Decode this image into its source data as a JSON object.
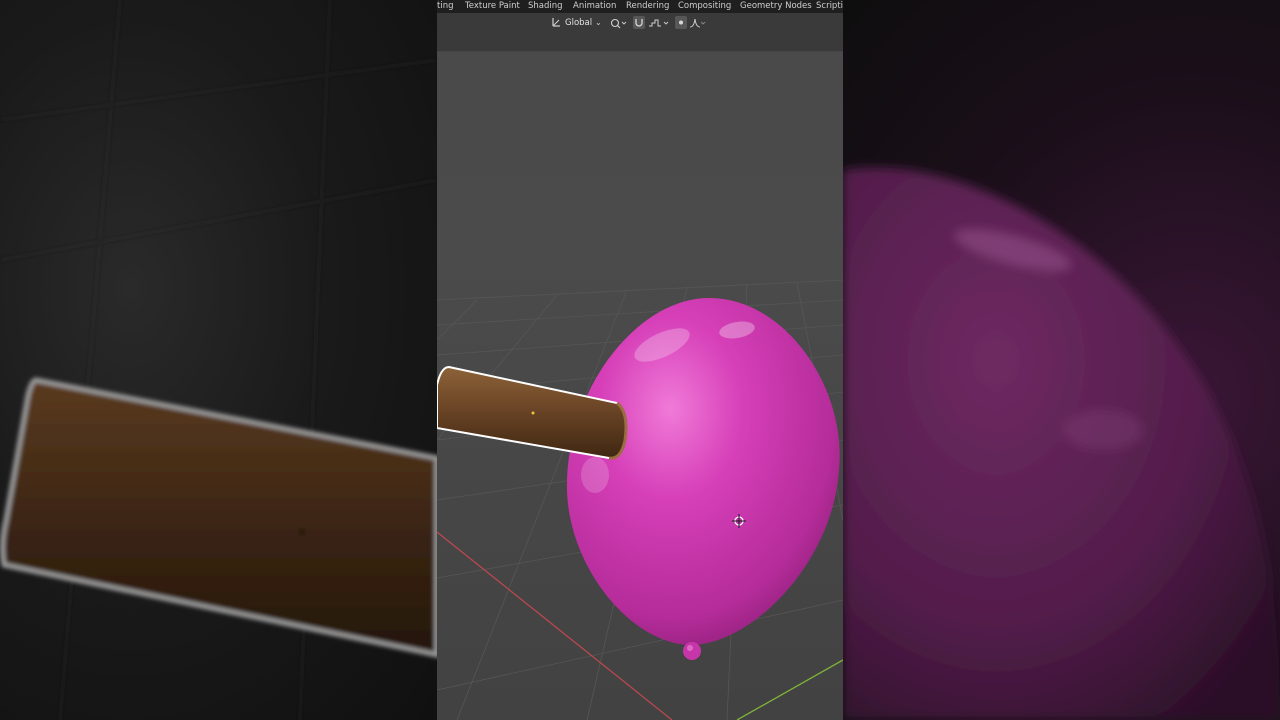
{
  "app": "Blender",
  "workspace_tabs": [
    {
      "label": "ting",
      "name": "tab-texturing-partial"
    },
    {
      "label": "Texture Paint",
      "name": "tab-texture-paint"
    },
    {
      "label": "Shading",
      "name": "tab-shading"
    },
    {
      "label": "Animation",
      "name": "tab-animation"
    },
    {
      "label": "Rendering",
      "name": "tab-rendering"
    },
    {
      "label": "Compositing",
      "name": "tab-compositing"
    },
    {
      "label": "Geometry Nodes",
      "name": "tab-geometry-nodes"
    },
    {
      "label": "Scriptin",
      "name": "tab-scripting-partial"
    }
  ],
  "header": {
    "orientation": "Global",
    "orientation_chevron": "⌄",
    "pivot_icon": "pivot-point-icon",
    "snap_icon": "snap-magnet-icon",
    "snap_increment_icon": "snap-increment-icon",
    "proportional_icon": "proportional-editing-icon",
    "falloff_icon": "falloff-curve-icon"
  },
  "scene": {
    "objects": [
      "wooden-stick",
      "balloon"
    ],
    "balloon_color": "#d23fb6",
    "stick_color": "#6b4526",
    "x_axis_color": "#b8484e",
    "y_axis_color": "#7fb23a"
  }
}
